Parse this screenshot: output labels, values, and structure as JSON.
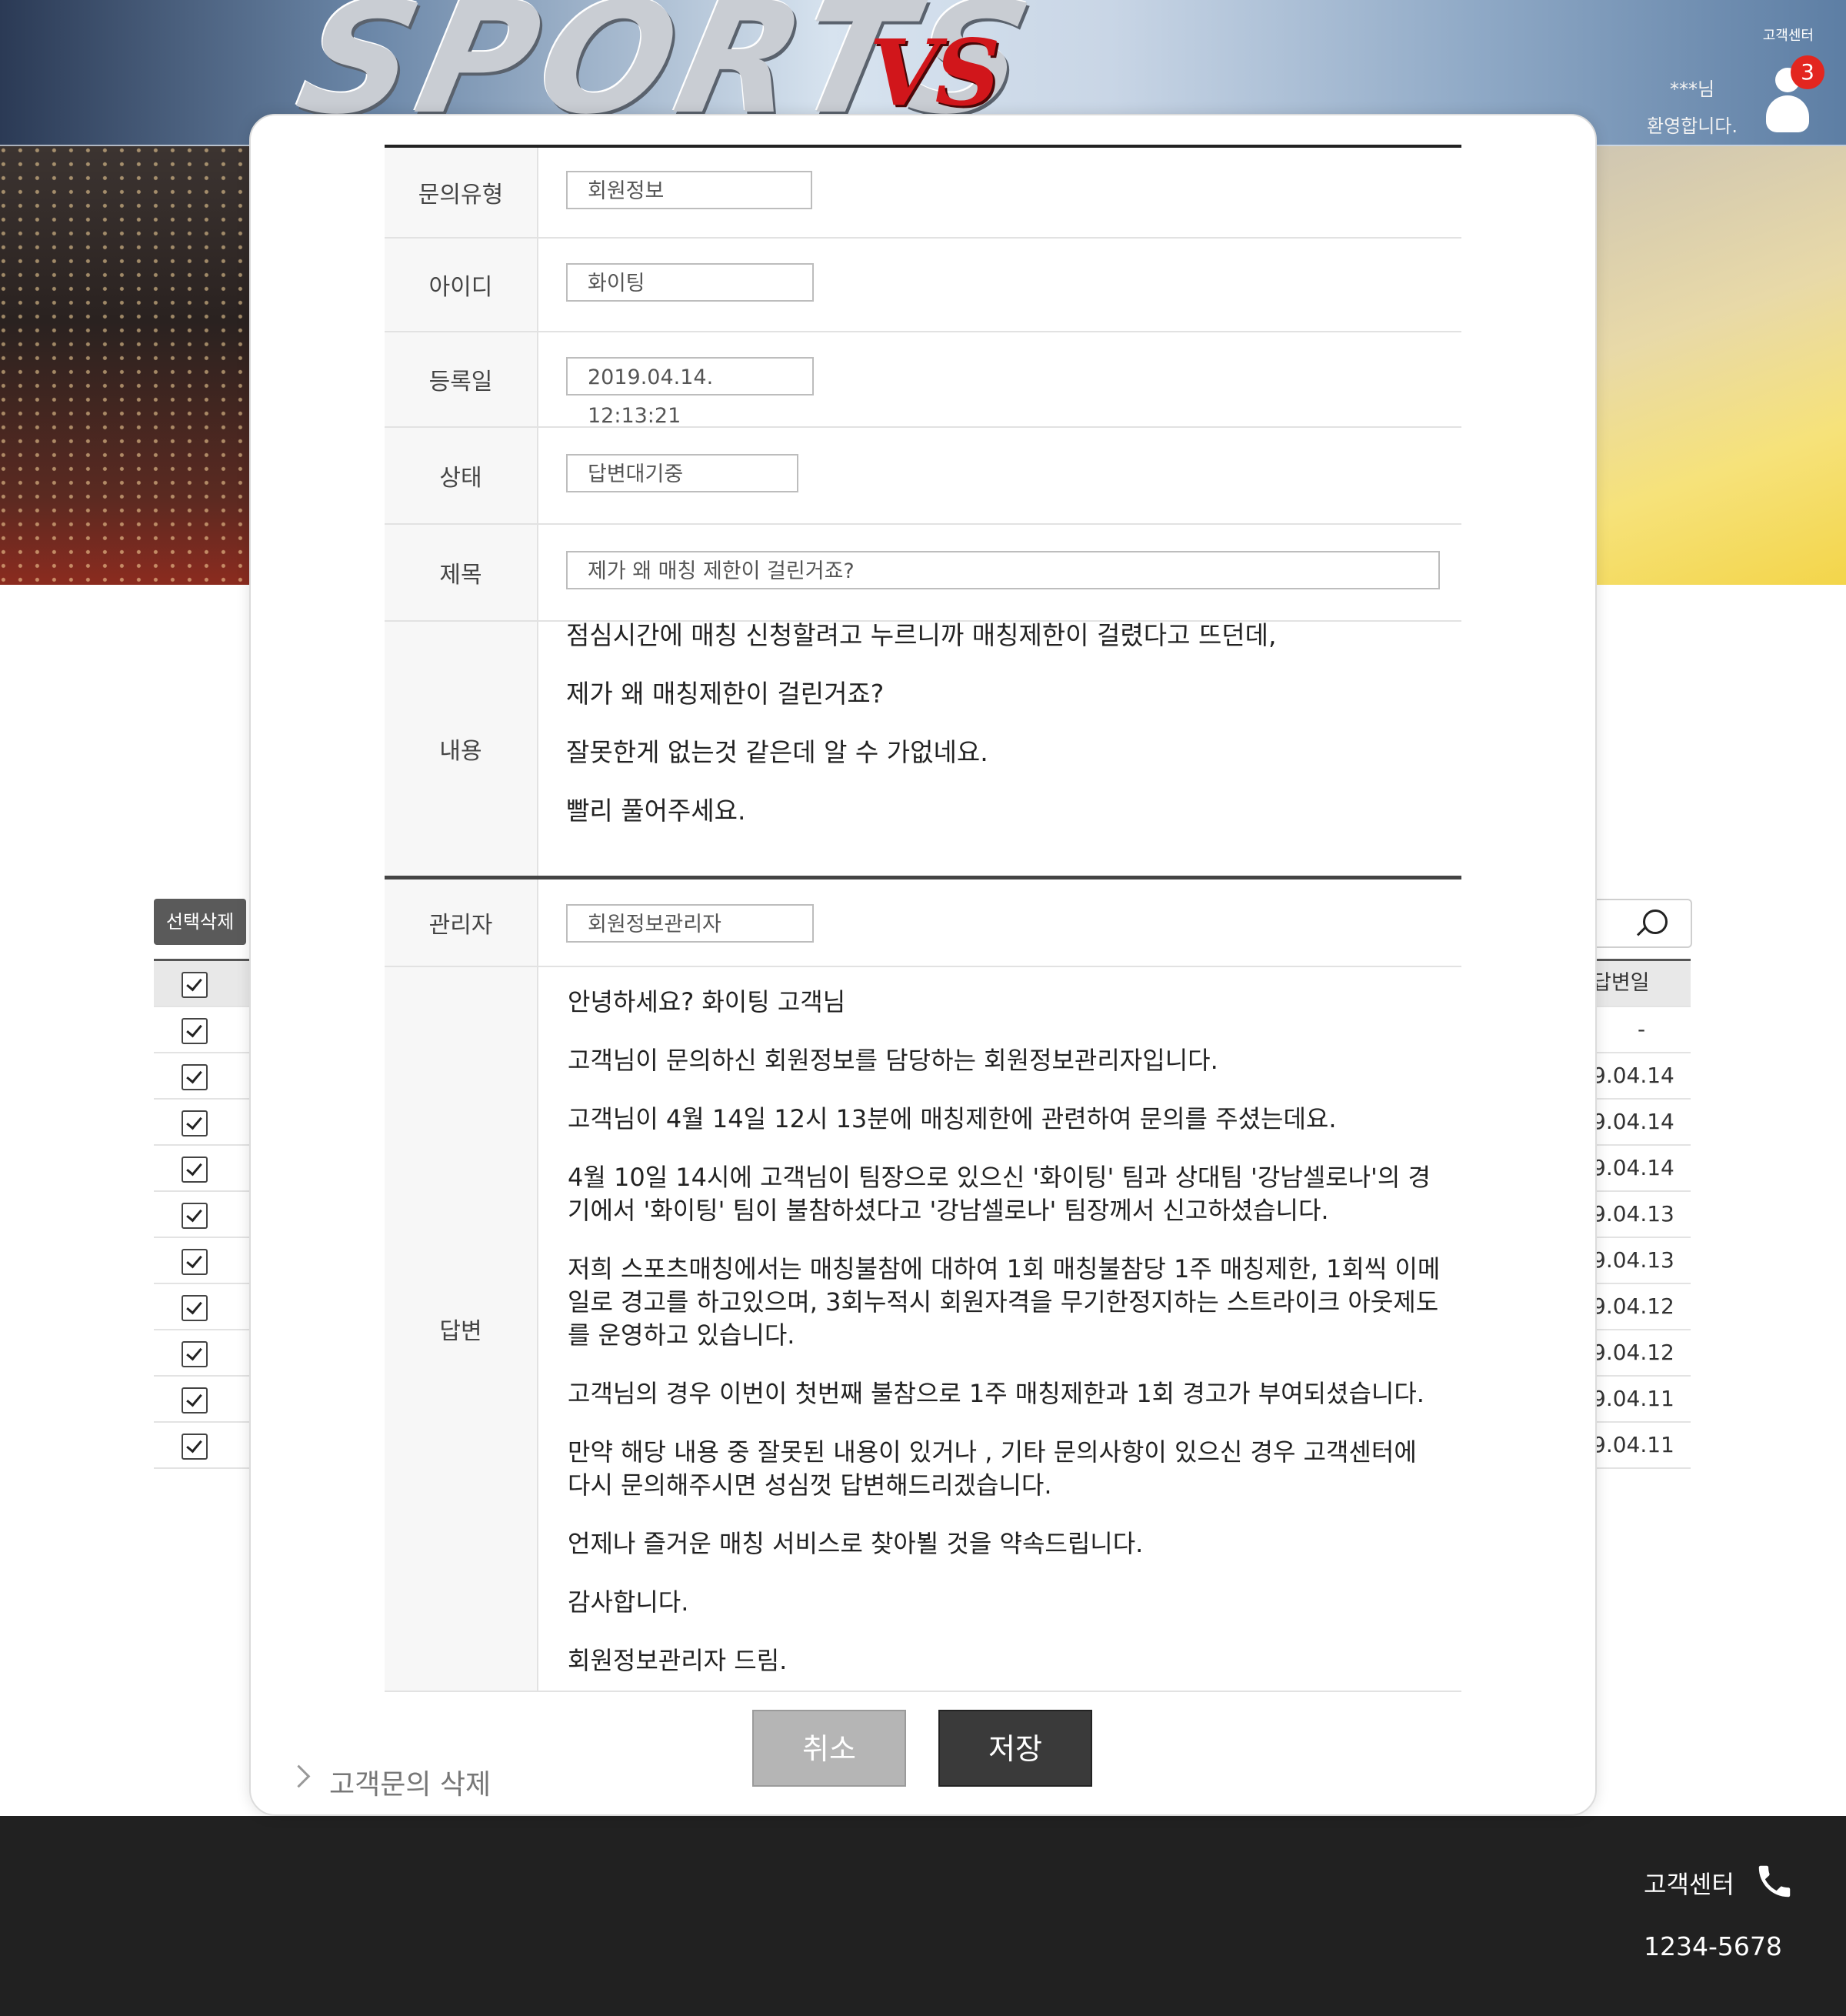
{
  "header": {
    "util_link": "고객센터",
    "user_masked": "***님",
    "welcome": "환영합니다.",
    "notification_count": "3",
    "logo_text": "VS",
    "banner_word": "SPORTS"
  },
  "list": {
    "bulk_delete_label": "선택삭제",
    "answer_date_header": "답변일",
    "answer_dates": [
      "-",
      "9.04.14",
      "9.04.14",
      "9.04.14",
      "9.04.13",
      "9.04.13",
      "9.04.12",
      "9.04.12",
      "9.04.11",
      "9.04.11"
    ]
  },
  "inquiry": {
    "type_label": "문의유형",
    "type_value": "회원정보",
    "id_label": "아이디",
    "id_value": "화이팅",
    "date_label": "등록일",
    "date_value": "2019.04.14. 12:13:21",
    "status_label": "상태",
    "status_value": "답변대기중",
    "title_label": "제목",
    "title_value": "제가 왜 매칭 제한이 걸린거죠?",
    "content_label": "내용",
    "content_lines": [
      "점심시간에 매칭 신청할려고 누르니까 매칭제한이 걸렸다고 뜨던데,",
      "제가 왜 매칭제한이 걸린거죠?",
      "잘못한게 없는것 같은데 알 수 가없네요.",
      "빨리 풀어주세요."
    ]
  },
  "reply": {
    "admin_label": "관리자",
    "admin_value": "회원정보관리자",
    "answer_label": "답변",
    "paragraphs": [
      "안녕하세요? 화이팅 고객님",
      "고객님이 문의하신 회원정보를 담당하는 회원정보관리자입니다.",
      "고객님이 4월 14일 12시 13분에 매칭제한에 관련하여 문의를 주셨는데요.",
      "4월 10일 14시에 고객님이 팀장으로 있으신 '화이팅' 팀과 상대팀 '강남셀로나'의 경기에서 '화이팅' 팀이 불참하셨다고 '강남셀로나' 팀장께서 신고하셨습니다.",
      "저희 스포츠매칭에서는 매칭불참에 대하여 1회 매칭불참당 1주 매칭제한, 1회씩 이메일로 경고를 하고있으며, 3회누적시 회원자격을 무기한정지하는 스트라이크 아웃제도를 운영하고 있습니다.",
      "고객님의 경우 이번이 첫번째 불참으로 1주 매칭제한과 1회 경고가 부여되셨습니다.",
      "만약 해당 내용 중 잘못된 내용이 있거나 , 기타 문의사항이 있으신 경우 고객센터에 다시 문의해주시면 성심껏 답변해드리겠습니다.",
      "언제나 즐거운 매칭 서비스로 찾아뵐 것을 약속드립니다.",
      "감사합니다.",
      "회원정보관리자 드림."
    ]
  },
  "actions": {
    "cancel_label": "취소",
    "save_label": "저장",
    "delete_link": "고객문의 삭제"
  },
  "footer": {
    "cs_label": "고객센터",
    "phone": "1234-5678"
  },
  "colors": {
    "badge": "#e3261f",
    "dark_button": "#3a3a3a",
    "footer_bg": "#212121"
  }
}
